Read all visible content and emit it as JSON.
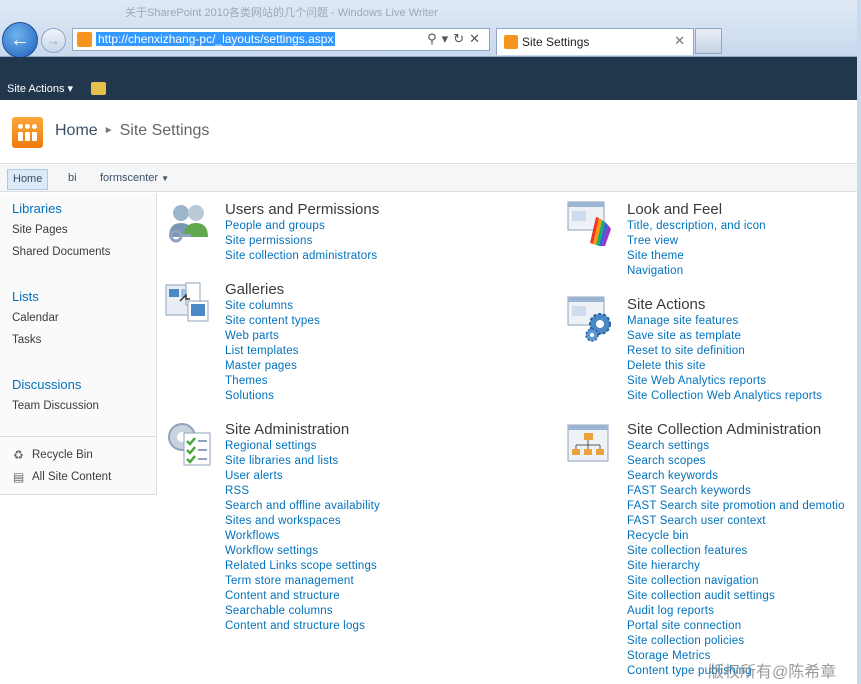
{
  "browser": {
    "window_title": "关于SharePoint 2010各类网站的几个问题 - Windows Live Writer",
    "url": "http://chenxizhang-pc/_layouts/settings.aspx",
    "tab_title": "Site Settings"
  },
  "ribbon": {
    "site_actions": "Site Actions"
  },
  "breadcrumb": {
    "home": "Home",
    "current": "Site Settings"
  },
  "topnav": [
    "Home",
    "bi",
    "formscenter"
  ],
  "leftnav": {
    "groups": [
      {
        "heading": "Libraries",
        "items": [
          "Site Pages",
          "Shared Documents"
        ]
      },
      {
        "heading": "Lists",
        "items": [
          "Calendar",
          "Tasks"
        ]
      },
      {
        "heading": "Discussions",
        "items": [
          "Team Discussion"
        ]
      }
    ],
    "recycle_bin": "Recycle Bin",
    "all_site_content": "All Site Content"
  },
  "sections": {
    "users": {
      "title": "Users and Permissions",
      "links": [
        "People and groups",
        "Site permissions",
        "Site collection administrators"
      ]
    },
    "galleries": {
      "title": "Galleries",
      "links": [
        "Site columns",
        "Site content types",
        "Web parts",
        "List templates",
        "Master pages",
        "Themes",
        "Solutions"
      ]
    },
    "site_admin": {
      "title": "Site Administration",
      "links": [
        "Regional settings",
        "Site libraries and lists",
        "User alerts",
        "RSS",
        "Search and offline availability",
        "Sites and workspaces",
        "Workflows",
        "Workflow settings",
        "Related Links scope settings",
        "Term store management",
        "Content and structure",
        "Searchable columns",
        "Content and structure logs"
      ]
    },
    "look_feel": {
      "title": "Look and Feel",
      "links": [
        "Title, description, and icon",
        "Tree view",
        "Site theme",
        "Navigation"
      ]
    },
    "site_actions": {
      "title": "Site Actions",
      "links": [
        "Manage site features",
        "Save site as template",
        "Reset to site definition",
        "Delete this site",
        "Site Web Analytics reports",
        "Site Collection Web Analytics reports"
      ]
    },
    "collection_admin": {
      "title": "Site Collection Administration",
      "links": [
        "Search settings",
        "Search scopes",
        "Search keywords",
        "FAST Search keywords",
        "FAST Search site promotion and demotio",
        "FAST Search user context",
        "Recycle bin",
        "Site collection features",
        "Site hierarchy",
        "Site collection navigation",
        "Site collection audit settings",
        "Audit log reports",
        "Portal site connection",
        "Site collection policies",
        "Storage Metrics",
        "Content type publishing"
      ]
    }
  },
  "watermark": "版权所有@陈希章"
}
